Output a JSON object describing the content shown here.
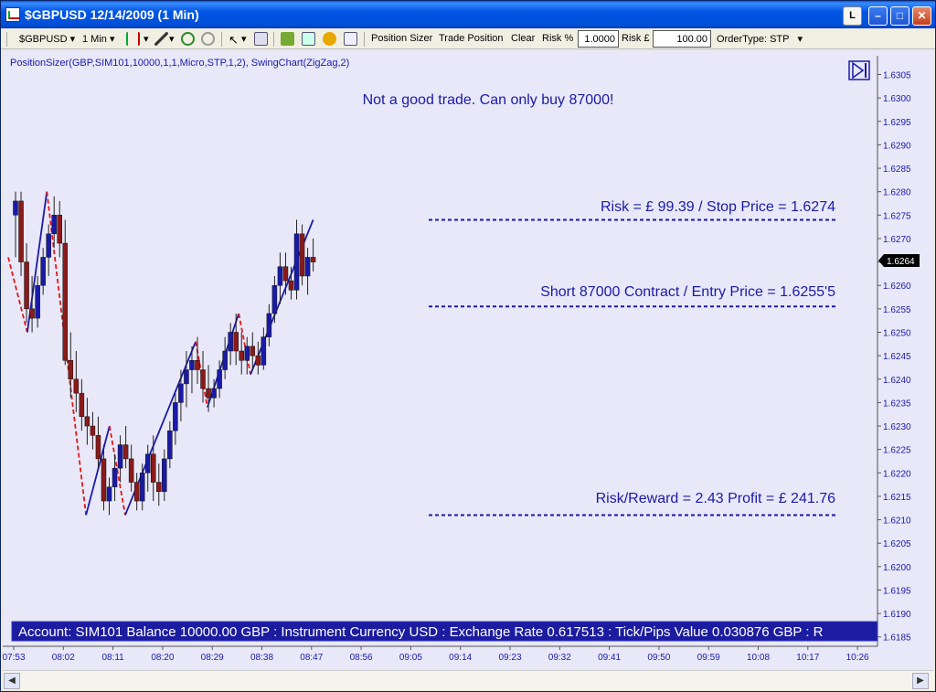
{
  "window": {
    "title": "$GBPUSD  12/14/2009 (1 Min)",
    "buttons": {
      "l": "L"
    }
  },
  "toolbar": {
    "instrument": "$GBPUSD",
    "interval": "1 Min",
    "position_sizer": "Position Sizer",
    "trade_position": "Trade Position",
    "clear": "Clear",
    "risk_pct_label": "Risk %",
    "risk_pct_value": "1.0000",
    "risk_gbp_label": "Risk £",
    "risk_gbp_value": "100.00",
    "order_type": "OrderType: STP"
  },
  "chart": {
    "indicator_label": "PositionSizer(GBP,SIM101,10000,1,1,Micro,STP,1,2), SwingChart(ZigZag,2)",
    "message": "Not a good trade.  Can only buy 87000!",
    "risk_text": "Risk = £ 99.39 / Stop Price = 1.6274",
    "entry_text": "Short 87000 Contract / Entry Price = 1.6255'5",
    "reward_text": "Risk/Reward = 2.43 Profit = £ 241.76",
    "account_text": "Account: SIM101 Balance 10000.00 GBP : Instrument Currency USD : Exchange Rate 0.617513 : Tick/Pips Value 0.030876 GBP : R",
    "current_price": "1.6264"
  },
  "colors": {
    "chart_bg": "#e8e8f8",
    "bull": "#1a1aa8",
    "bear": "#8b1a1a",
    "zigzag_up": "#1a1aa8",
    "zigzag_down": "#e01818",
    "level_line": "#1a1aa8",
    "text_blue": "#1a1aa8"
  },
  "chart_data": {
    "type": "candlestick",
    "y_ticks": [
      "1.6305",
      "1.6300",
      "1.6295",
      "1.6290",
      "1.6285",
      "1.6280",
      "1.6275",
      "1.6270",
      "1.6265",
      "1.6260",
      "1.6255",
      "1.6250",
      "1.6245",
      "1.6240",
      "1.6235",
      "1.6230",
      "1.6225",
      "1.6220",
      "1.6215",
      "1.6210",
      "1.6205",
      "1.6200",
      "1.6195",
      "1.6190",
      "1.6185"
    ],
    "x_ticks": [
      "07:53",
      "08:02",
      "08:11",
      "08:20",
      "08:29",
      "08:38",
      "08:47",
      "08:56",
      "09:05",
      "09:14",
      "09:23",
      "09:32",
      "09:41",
      "09:50",
      "09:59",
      "10:08",
      "10:17",
      "10:26"
    ],
    "ylim": [
      1.6183,
      1.6309
    ],
    "levels": {
      "stop": 1.6274,
      "entry": 1.62555,
      "target": 1.6211
    },
    "bars": [
      [
        1.6275,
        1.628,
        1.6266,
        1.6278
      ],
      [
        1.6278,
        1.628,
        1.6262,
        1.6265
      ],
      [
        1.6265,
        1.6269,
        1.6252,
        1.6255
      ],
      [
        1.6255,
        1.6262,
        1.625,
        1.6253
      ],
      [
        1.6253,
        1.6262,
        1.6251,
        1.626
      ],
      [
        1.626,
        1.6268,
        1.6258,
        1.6266
      ],
      [
        1.6266,
        1.6273,
        1.6262,
        1.6271
      ],
      [
        1.6271,
        1.6279,
        1.6268,
        1.6275
      ],
      [
        1.6275,
        1.6278,
        1.6266,
        1.6269
      ],
      [
        1.6269,
        1.6274,
        1.6243,
        1.6244
      ],
      [
        1.6244,
        1.625,
        1.6236,
        1.624
      ],
      [
        1.624,
        1.6246,
        1.6233,
        1.6237
      ],
      [
        1.6237,
        1.624,
        1.6229,
        1.6232
      ],
      [
        1.6232,
        1.6236,
        1.6226,
        1.623
      ],
      [
        1.623,
        1.6233,
        1.6225,
        1.6228
      ],
      [
        1.6228,
        1.6232,
        1.6221,
        1.6223
      ],
      [
        1.6223,
        1.6226,
        1.6212,
        1.6214
      ],
      [
        1.6214,
        1.6219,
        1.6211,
        1.6217
      ],
      [
        1.6217,
        1.6224,
        1.6214,
        1.6221
      ],
      [
        1.6221,
        1.6228,
        1.6218,
        1.6226
      ],
      [
        1.6226,
        1.623,
        1.6221,
        1.6223
      ],
      [
        1.6223,
        1.6226,
        1.6216,
        1.6218
      ],
      [
        1.6218,
        1.622,
        1.6212,
        1.6214
      ],
      [
        1.6214,
        1.6222,
        1.6212,
        1.622
      ],
      [
        1.622,
        1.6226,
        1.6216,
        1.6224
      ],
      [
        1.6224,
        1.6228,
        1.6214,
        1.6218
      ],
      [
        1.6218,
        1.6222,
        1.6213,
        1.6216
      ],
      [
        1.6216,
        1.6225,
        1.6214,
        1.6223
      ],
      [
        1.6223,
        1.6231,
        1.6221,
        1.6229
      ],
      [
        1.6229,
        1.6237,
        1.6226,
        1.6235
      ],
      [
        1.6235,
        1.6242,
        1.6231,
        1.6239
      ],
      [
        1.6239,
        1.6246,
        1.6234,
        1.6242
      ],
      [
        1.6242,
        1.6247,
        1.6237,
        1.6244
      ],
      [
        1.6244,
        1.6249,
        1.6239,
        1.6242
      ],
      [
        1.6242,
        1.6246,
        1.6235,
        1.6238
      ],
      [
        1.6238,
        1.6243,
        1.6233,
        1.6236
      ],
      [
        1.6236,
        1.624,
        1.6234,
        1.6238
      ],
      [
        1.6238,
        1.6244,
        1.6236,
        1.6242
      ],
      [
        1.6242,
        1.6249,
        1.624,
        1.6246
      ],
      [
        1.6246,
        1.6252,
        1.6243,
        1.625
      ],
      [
        1.625,
        1.6254,
        1.6243,
        1.6246
      ],
      [
        1.6246,
        1.625,
        1.6241,
        1.6244
      ],
      [
        1.6244,
        1.6249,
        1.6241,
        1.6247
      ],
      [
        1.6247,
        1.625,
        1.6242,
        1.6245
      ],
      [
        1.6245,
        1.6248,
        1.6241,
        1.6243
      ],
      [
        1.6243,
        1.6251,
        1.6242,
        1.6249
      ],
      [
        1.6249,
        1.6256,
        1.6247,
        1.6254
      ],
      [
        1.6254,
        1.6262,
        1.6252,
        1.626
      ],
      [
        1.626,
        1.6267,
        1.6256,
        1.6264
      ],
      [
        1.6264,
        1.6267,
        1.6258,
        1.6261
      ],
      [
        1.6261,
        1.6264,
        1.6257,
        1.6259
      ],
      [
        1.6259,
        1.6274,
        1.6257,
        1.6271
      ],
      [
        1.6271,
        1.6273,
        1.626,
        1.6262
      ],
      [
        1.6262,
        1.6268,
        1.6258,
        1.6266
      ],
      [
        1.6266,
        1.627,
        1.6263,
        1.6265
      ]
    ]
  }
}
